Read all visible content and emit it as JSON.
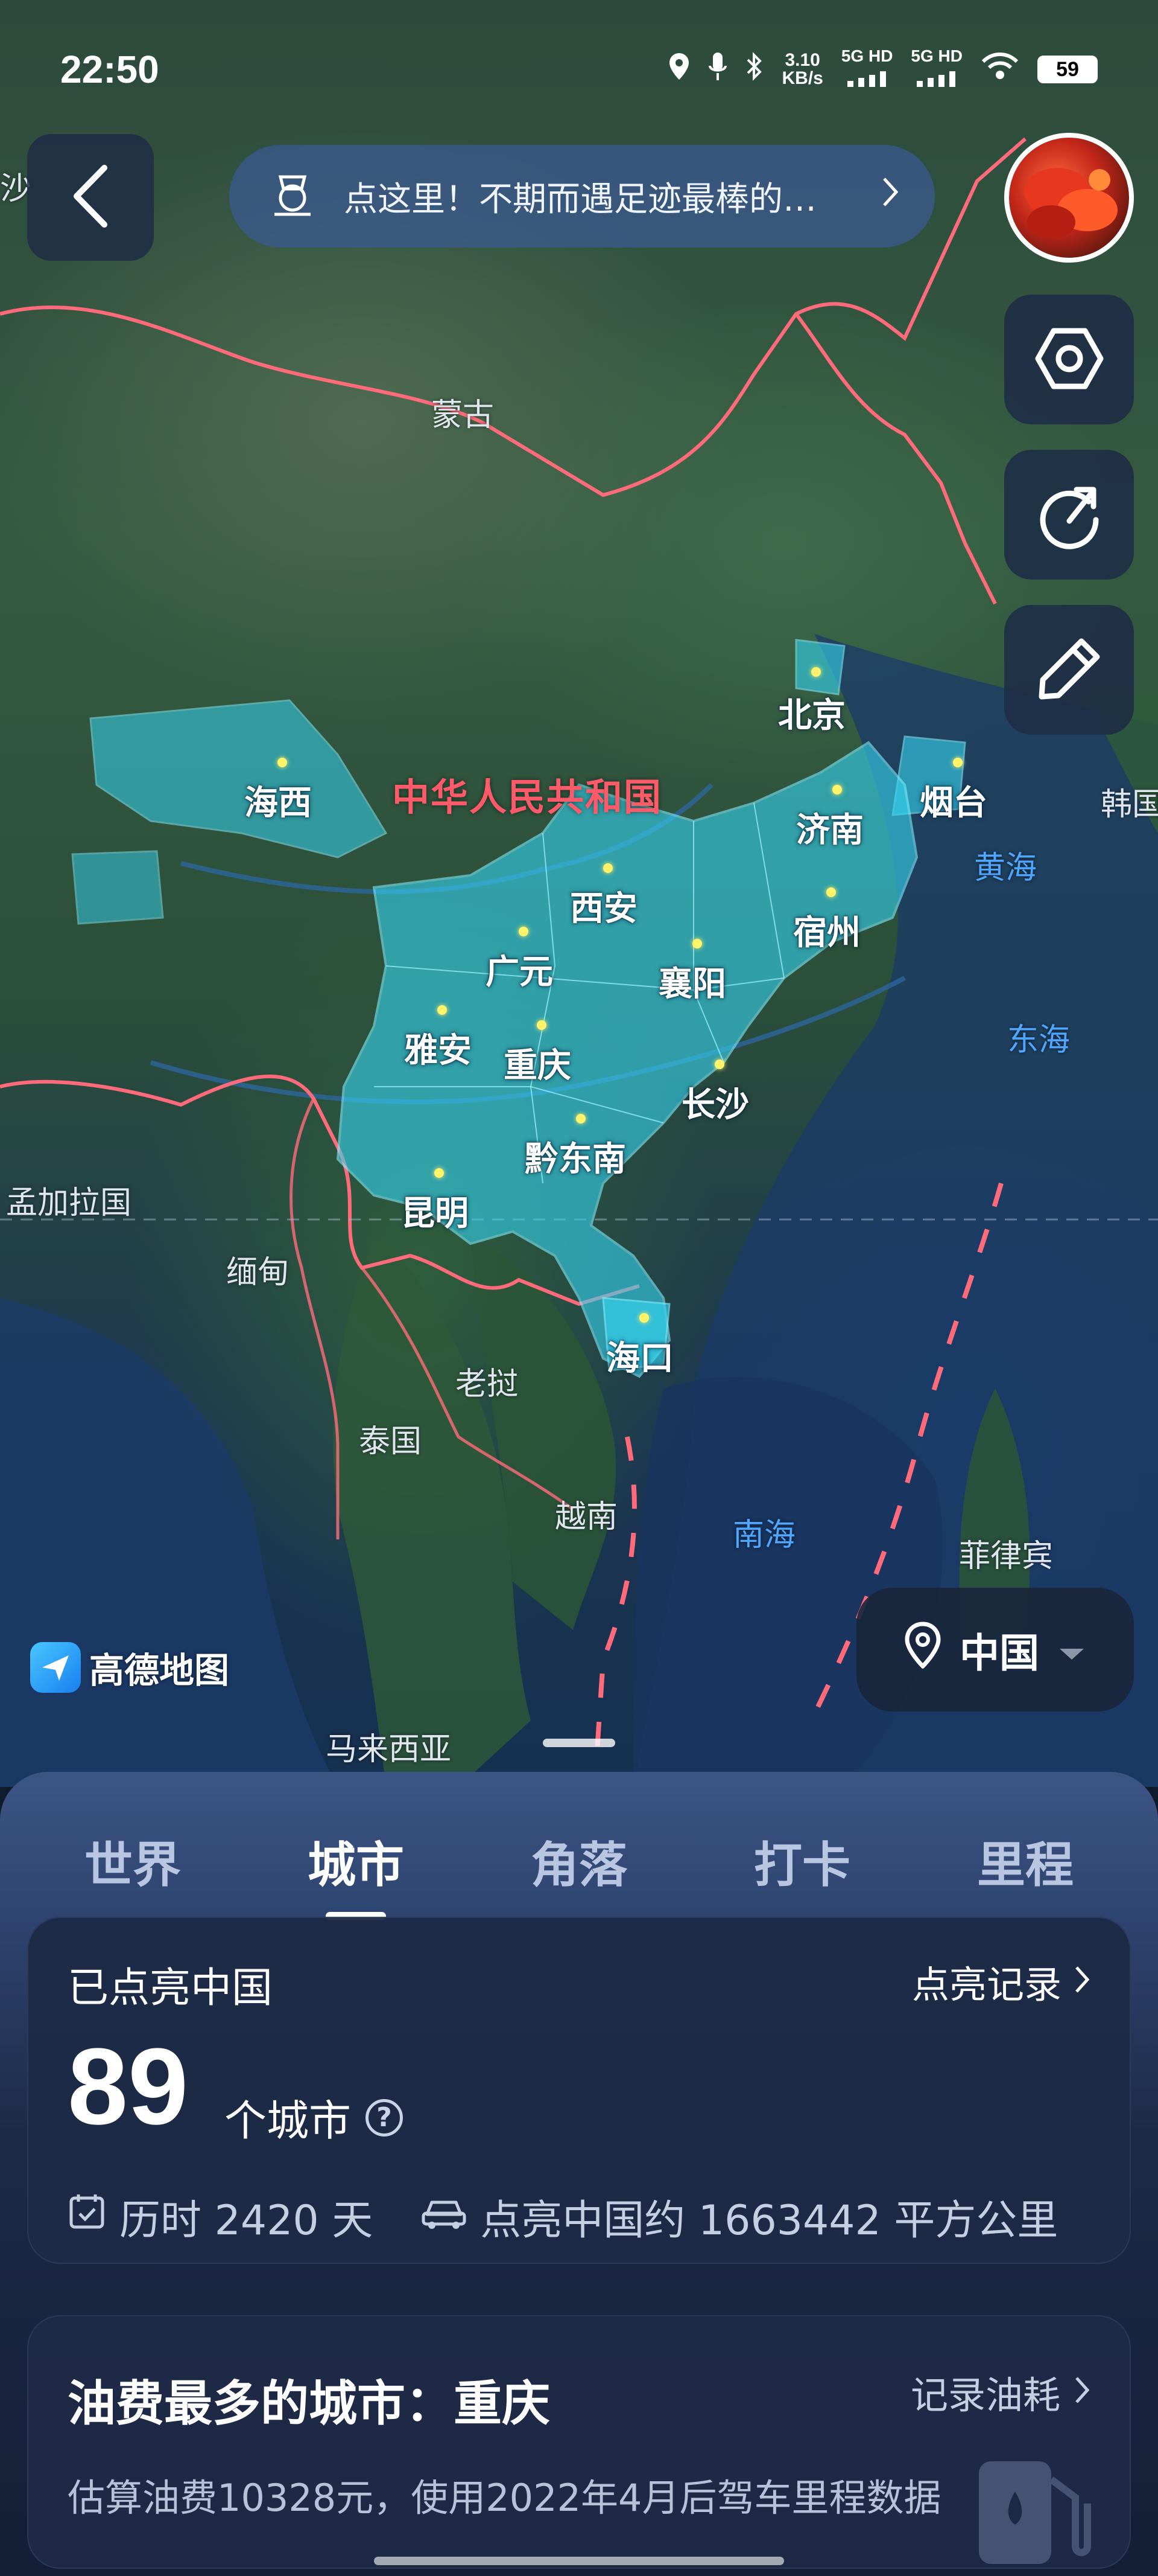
{
  "status_bar": {
    "time": "22:50",
    "net_speed_value": "3.10",
    "net_speed_unit": "KB/s",
    "sim1": "5G HD",
    "sim2": "5G HD",
    "battery": "59"
  },
  "banner": {
    "text": "点这里！不期而遇足迹最棒的…"
  },
  "map": {
    "country_title": "中华人民共和国",
    "labels": [
      {
        "id": "mongolia",
        "text": "蒙古"
      },
      {
        "id": "bangladesh",
        "text": "孟加拉国"
      },
      {
        "id": "myanmar",
        "text": "缅甸"
      },
      {
        "id": "laos",
        "text": "老挝"
      },
      {
        "id": "thailand",
        "text": "泰国"
      },
      {
        "id": "vietnam",
        "text": "越南"
      },
      {
        "id": "philippines",
        "text": "菲律宾"
      },
      {
        "id": "malaysia",
        "text": "马来西亚"
      },
      {
        "id": "korea",
        "text": "韩国"
      },
      {
        "id": "partial-left",
        "text": "沙"
      }
    ],
    "water_labels": [
      {
        "id": "yellow-sea",
        "text": "黄海"
      },
      {
        "id": "east-sea",
        "text": "东海"
      },
      {
        "id": "south-sea",
        "text": "南海"
      }
    ],
    "cities": [
      {
        "id": "beijing",
        "text": "北京"
      },
      {
        "id": "yantai",
        "text": "烟台"
      },
      {
        "id": "haixi",
        "text": "海西"
      },
      {
        "id": "jinan",
        "text": "济南"
      },
      {
        "id": "xian",
        "text": "西安"
      },
      {
        "id": "suzhou",
        "text": "宿州"
      },
      {
        "id": "guangyuan",
        "text": "广元"
      },
      {
        "id": "xiangyang",
        "text": "襄阳"
      },
      {
        "id": "yaan",
        "text": "雅安"
      },
      {
        "id": "chongqing",
        "text": "重庆"
      },
      {
        "id": "changsha",
        "text": "长沙"
      },
      {
        "id": "qiandongnan",
        "text": "黔东南"
      },
      {
        "id": "kunming",
        "text": "昆明"
      },
      {
        "id": "haikou",
        "text": "海口"
      }
    ],
    "logo_text": "高德地图",
    "region_selector": "中国"
  },
  "tabs": [
    {
      "label": "世界",
      "active": false
    },
    {
      "label": "城市",
      "active": true
    },
    {
      "label": "角落",
      "active": false
    },
    {
      "label": "打卡",
      "active": false
    },
    {
      "label": "里程",
      "active": false
    }
  ],
  "summary_card": {
    "title": "已点亮中国",
    "link": "点亮记录",
    "count": "89",
    "unit": "个城市",
    "help": "?",
    "duration": "历时 2420 天",
    "area": "点亮中国约 1663442 平方公里"
  },
  "fuel_card": {
    "title": "油费最多的城市：重庆",
    "link": "记录油耗",
    "description": "估算油费10328元，使用2022年4月后驾车里程数据"
  },
  "colors": {
    "lit_region": "#35d4f0",
    "border_red": "#ff5a6a",
    "panel_bg": "#1c2a46",
    "water_label": "#4fa6ff"
  }
}
